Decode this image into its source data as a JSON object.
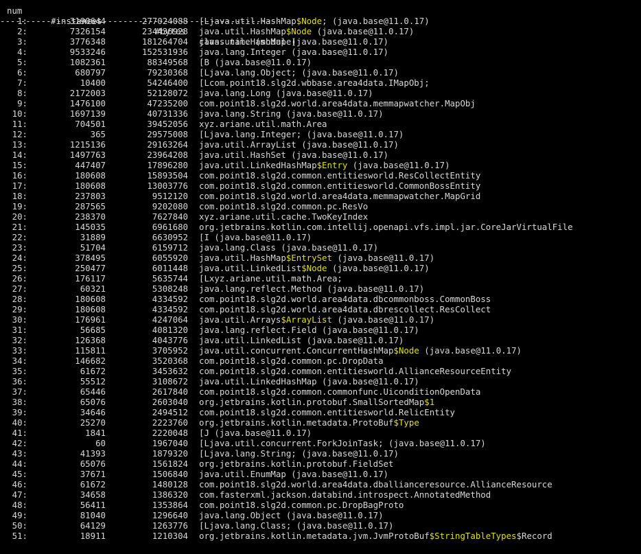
{
  "top_text": "num   #instances   #bytes  class name (module)",
  "header": {
    "num": "num",
    "instances": "#instances",
    "bytes": "#bytes",
    "class_name": "class name (module)"
  },
  "separator": "-------------------------------------------------------",
  "highlight_color": "#e0e000",
  "text_color": "#d8d8d8",
  "background_color": "#000000",
  "rows": [
    {
      "num": "1:",
      "instances": "3190644",
      "bytes": "277024088",
      "segs": [
        {
          "t": "[Ljava.util.HashMap",
          "h": false
        },
        {
          "t": "$Node",
          "h": true
        },
        {
          "t": "; (java.base@11.0.17)",
          "h": false
        }
      ]
    },
    {
      "num": "2:",
      "instances": "7326154",
      "bytes": "234436928",
      "segs": [
        {
          "t": "java.util.HashMap",
          "h": false
        },
        {
          "t": "$Node",
          "h": true
        },
        {
          "t": " (java.base@11.0.17)",
          "h": false
        }
      ]
    },
    {
      "num": "3:",
      "instances": "3776348",
      "bytes": "181264704",
      "segs": [
        {
          "t": "java.util.HashMap (java.base@11.0.17)",
          "h": false
        }
      ]
    },
    {
      "num": "4:",
      "instances": "9533246",
      "bytes": "152531936",
      "segs": [
        {
          "t": "java.lang.Integer (java.base@11.0.17)",
          "h": false
        }
      ]
    },
    {
      "num": "5:",
      "instances": "1082361",
      "bytes": "88349568",
      "segs": [
        {
          "t": "[B (java.base@11.0.17)",
          "h": false
        }
      ]
    },
    {
      "num": "6:",
      "instances": "680797",
      "bytes": "79230368",
      "segs": [
        {
          "t": "[Ljava.lang.Object; (java.base@11.0.17)",
          "h": false
        }
      ]
    },
    {
      "num": "7:",
      "instances": "10400",
      "bytes": "54246400",
      "segs": [
        {
          "t": "[Lcom.point18.slg2d.wbbase.area4data.IMapObj;",
          "h": false
        }
      ]
    },
    {
      "num": "8:",
      "instances": "2172003",
      "bytes": "52128072",
      "segs": [
        {
          "t": "java.lang.Long (java.base@11.0.17)",
          "h": false
        }
      ]
    },
    {
      "num": "9:",
      "instances": "1476100",
      "bytes": "47235200",
      "segs": [
        {
          "t": "com.point18.slg2d.world.area4data.memmapwatcher.MapObj",
          "h": false
        }
      ]
    },
    {
      "num": "10:",
      "instances": "1697139",
      "bytes": "40731336",
      "segs": [
        {
          "t": "java.lang.String (java.base@11.0.17)",
          "h": false
        }
      ]
    },
    {
      "num": "11:",
      "instances": "704501",
      "bytes": "39452056",
      "segs": [
        {
          "t": "xyz.ariane.util.math.Area",
          "h": false
        }
      ]
    },
    {
      "num": "12:",
      "instances": "365",
      "bytes": "29575008",
      "segs": [
        {
          "t": "[Ljava.lang.Integer; (java.base@11.0.17)",
          "h": false
        }
      ]
    },
    {
      "num": "13:",
      "instances": "1215136",
      "bytes": "29163264",
      "segs": [
        {
          "t": "java.util.ArrayList (java.base@11.0.17)",
          "h": false
        }
      ]
    },
    {
      "num": "14:",
      "instances": "1497763",
      "bytes": "23964208",
      "segs": [
        {
          "t": "java.util.HashSet (java.base@11.0.17)",
          "h": false
        }
      ]
    },
    {
      "num": "15:",
      "instances": "447407",
      "bytes": "17896280",
      "segs": [
        {
          "t": "java.util.LinkedHashMap",
          "h": false
        },
        {
          "t": "$Entry",
          "h": true
        },
        {
          "t": " (java.base@11.0.17)",
          "h": false
        }
      ]
    },
    {
      "num": "16:",
      "instances": "180608",
      "bytes": "15893504",
      "segs": [
        {
          "t": "com.point18.slg2d.common.entitiesworld.ResCollectEntity",
          "h": false
        }
      ]
    },
    {
      "num": "17:",
      "instances": "180608",
      "bytes": "13003776",
      "segs": [
        {
          "t": "com.point18.slg2d.common.entitiesworld.CommonBossEntity",
          "h": false
        }
      ]
    },
    {
      "num": "18:",
      "instances": "237803",
      "bytes": "9512120",
      "segs": [
        {
          "t": "com.point18.slg2d.world.area4data.memmapwatcher.MapGrid",
          "h": false
        }
      ]
    },
    {
      "num": "19:",
      "instances": "287565",
      "bytes": "9202080",
      "segs": [
        {
          "t": "com.point18.slg2d.common.pc.ResVo",
          "h": false
        }
      ]
    },
    {
      "num": "20:",
      "instances": "238370",
      "bytes": "7627840",
      "segs": [
        {
          "t": "xyz.ariane.util.cache.TwoKeyIndex",
          "h": false
        }
      ]
    },
    {
      "num": "21:",
      "instances": "145035",
      "bytes": "6961680",
      "segs": [
        {
          "t": "org.jetbrains.kotlin.com.intellij.openapi.vfs.impl.jar.CoreJarVirtualFile",
          "h": false
        }
      ]
    },
    {
      "num": "22:",
      "instances": "31889",
      "bytes": "6630952",
      "segs": [
        {
          "t": "[I (java.base@11.0.17)",
          "h": false
        }
      ]
    },
    {
      "num": "23:",
      "instances": "51704",
      "bytes": "6159712",
      "segs": [
        {
          "t": "java.lang.Class (java.base@11.0.17)",
          "h": false
        }
      ]
    },
    {
      "num": "24:",
      "instances": "378495",
      "bytes": "6055920",
      "segs": [
        {
          "t": "java.util.HashMap",
          "h": false
        },
        {
          "t": "$EntrySet",
          "h": true
        },
        {
          "t": " (java.base@11.0.17)",
          "h": false
        }
      ]
    },
    {
      "num": "25:",
      "instances": "250477",
      "bytes": "6011448",
      "segs": [
        {
          "t": "java.util.LinkedList",
          "h": false
        },
        {
          "t": "$Node",
          "h": true
        },
        {
          "t": " (java.base@11.0.17)",
          "h": false
        }
      ]
    },
    {
      "num": "26:",
      "instances": "176117",
      "bytes": "5635744",
      "segs": [
        {
          "t": "[Lxyz.ariane.util.math.Area;",
          "h": false
        }
      ]
    },
    {
      "num": "27:",
      "instances": "60321",
      "bytes": "5308248",
      "segs": [
        {
          "t": "java.lang.reflect.Method (java.base@11.0.17)",
          "h": false
        }
      ]
    },
    {
      "num": "28:",
      "instances": "180608",
      "bytes": "4334592",
      "segs": [
        {
          "t": "com.point18.slg2d.world.area4data.dbcommonboss.CommonBoss",
          "h": false
        }
      ]
    },
    {
      "num": "29:",
      "instances": "180608",
      "bytes": "4334592",
      "segs": [
        {
          "t": "com.point18.slg2d.world.area4data.dbrescollect.ResCollect",
          "h": false
        }
      ]
    },
    {
      "num": "30:",
      "instances": "176961",
      "bytes": "4247064",
      "segs": [
        {
          "t": "java.util.Arrays",
          "h": false
        },
        {
          "t": "$ArrayList",
          "h": true
        },
        {
          "t": " (java.base@11.0.17)",
          "h": false
        }
      ]
    },
    {
      "num": "31:",
      "instances": "56685",
      "bytes": "4081320",
      "segs": [
        {
          "t": "java.lang.reflect.Field (java.base@11.0.17)",
          "h": false
        }
      ]
    },
    {
      "num": "32:",
      "instances": "126368",
      "bytes": "4043776",
      "segs": [
        {
          "t": "java.util.LinkedList (java.base@11.0.17)",
          "h": false
        }
      ]
    },
    {
      "num": "33:",
      "instances": "115811",
      "bytes": "3705952",
      "segs": [
        {
          "t": "java.util.concurrent.ConcurrentHashMap",
          "h": false
        },
        {
          "t": "$Node",
          "h": true
        },
        {
          "t": " (java.base@11.0.17)",
          "h": false
        }
      ]
    },
    {
      "num": "34:",
      "instances": "146682",
      "bytes": "3520368",
      "segs": [
        {
          "t": "com.point18.slg2d.common.pc.DropData",
          "h": false
        }
      ]
    },
    {
      "num": "35:",
      "instances": "61672",
      "bytes": "3453632",
      "segs": [
        {
          "t": "com.point18.slg2d.common.entitiesworld.AllianceResourceEntity",
          "h": false
        }
      ]
    },
    {
      "num": "36:",
      "instances": "55512",
      "bytes": "3108672",
      "segs": [
        {
          "t": "java.util.LinkedHashMap (java.base@11.0.17)",
          "h": false
        }
      ]
    },
    {
      "num": "37:",
      "instances": "65446",
      "bytes": "2617840",
      "segs": [
        {
          "t": "com.point18.slg2d.common.commonfunc.UiconditionOpenData",
          "h": false
        }
      ]
    },
    {
      "num": "38:",
      "instances": "65076",
      "bytes": "2603040",
      "segs": [
        {
          "t": "org.jetbrains.kotlin.protobuf.SmallSortedMap",
          "h": false
        },
        {
          "t": "$1",
          "h": true
        }
      ]
    },
    {
      "num": "39:",
      "instances": "34646",
      "bytes": "2494512",
      "segs": [
        {
          "t": "com.point18.slg2d.common.entitiesworld.RelicEntity",
          "h": false
        }
      ]
    },
    {
      "num": "40:",
      "instances": "25270",
      "bytes": "2223760",
      "segs": [
        {
          "t": "org.jetbrains.kotlin.metadata.ProtoBuf",
          "h": false
        },
        {
          "t": "$Type",
          "h": true
        }
      ]
    },
    {
      "num": "41:",
      "instances": "1841",
      "bytes": "2220048",
      "segs": [
        {
          "t": "[J (java.base@11.0.17)",
          "h": false
        }
      ]
    },
    {
      "num": "42:",
      "instances": "60",
      "bytes": "1967040",
      "segs": [
        {
          "t": "[Ljava.util.concurrent.ForkJoinTask; (java.base@11.0.17)",
          "h": false
        }
      ]
    },
    {
      "num": "43:",
      "instances": "41393",
      "bytes": "1879320",
      "segs": [
        {
          "t": "[Ljava.lang.String; (java.base@11.0.17)",
          "h": false
        }
      ]
    },
    {
      "num": "44:",
      "instances": "65076",
      "bytes": "1561824",
      "segs": [
        {
          "t": "org.jetbrains.kotlin.protobuf.FieldSet",
          "h": false
        }
      ]
    },
    {
      "num": "45:",
      "instances": "37671",
      "bytes": "1506840",
      "segs": [
        {
          "t": "java.util.EnumMap (java.base@11.0.17)",
          "h": false
        }
      ]
    },
    {
      "num": "46:",
      "instances": "61672",
      "bytes": "1480128",
      "segs": [
        {
          "t": "com.point18.slg2d.world.area4data.dballianceresource.AllianceResource",
          "h": false
        }
      ]
    },
    {
      "num": "47:",
      "instances": "34658",
      "bytes": "1386320",
      "segs": [
        {
          "t": "com.fasterxml.jackson.databind.introspect.AnnotatedMethod",
          "h": false
        }
      ]
    },
    {
      "num": "48:",
      "instances": "56411",
      "bytes": "1353864",
      "segs": [
        {
          "t": "com.point18.slg2d.common.pc.DropBagProto",
          "h": false
        }
      ]
    },
    {
      "num": "49:",
      "instances": "81040",
      "bytes": "1296640",
      "segs": [
        {
          "t": "java.lang.Object (java.base@11.0.17)",
          "h": false
        }
      ]
    },
    {
      "num": "50:",
      "instances": "64129",
      "bytes": "1263776",
      "segs": [
        {
          "t": "[Ljava.lang.Class; (java.base@11.0.17)",
          "h": false
        }
      ]
    },
    {
      "num": "51:",
      "instances": "18911",
      "bytes": "1210304",
      "segs": [
        {
          "t": "org.jetbrains.kotlin.metadata.jvm.JvmProtoBuf",
          "h": false
        },
        {
          "t": "$StringTableTypes",
          "h": true
        },
        {
          "t": "$Record",
          "h": false
        }
      ]
    }
  ]
}
